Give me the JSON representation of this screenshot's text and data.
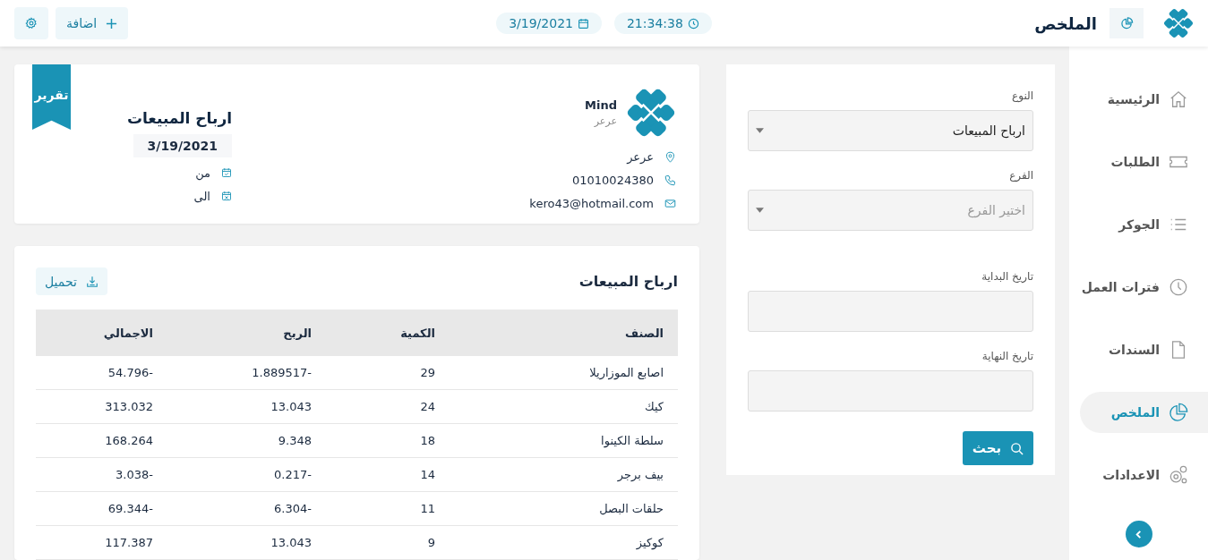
{
  "header": {
    "title": "الملخص",
    "time": "21:34:38",
    "date": "3/19/2021",
    "add_button": "اضافة"
  },
  "sidebar": {
    "items": [
      {
        "label": "الرئيسية",
        "kind": "home",
        "selected": false
      },
      {
        "label": "الطلبات",
        "kind": "ticket",
        "selected": false
      },
      {
        "label": "الجوكر",
        "kind": "list",
        "selected": false
      },
      {
        "label": "فترات العمل",
        "kind": "clock",
        "selected": false
      },
      {
        "label": "السندات",
        "kind": "file",
        "selected": false
      },
      {
        "label": "الملخص",
        "kind": "pie",
        "selected": true
      },
      {
        "label": "الاعدادات",
        "kind": "gears",
        "selected": false
      }
    ]
  },
  "filters": {
    "type": {
      "label": "النوع",
      "value": "ارباح المبيعات"
    },
    "branch": {
      "label": "الفرع",
      "placeholder": "اختير الفرع"
    },
    "start_date": {
      "label": "تاريخ البداية"
    },
    "end_date": {
      "label": "تاريخ النهاية"
    },
    "search_button": "بحث"
  },
  "report": {
    "ribbon": "تقرير",
    "company": "Mind",
    "company_sub": "عرعر",
    "location": "عرعر",
    "phone": "01010024380",
    "email": "kero43@hotmail.com",
    "title": "ارباح المبيعات",
    "date": "3/19/2021",
    "from_label": "من",
    "to_label": "الى"
  },
  "table": {
    "title": "ارباح المبيعات",
    "download_button": "تحميل",
    "columns": [
      "الصنف",
      "الكمية",
      "الربح",
      "الاجمالي"
    ],
    "rows": [
      [
        "اصابع الموزاريلا",
        "29",
        "-1.889517",
        "-54.796"
      ],
      [
        "كيك",
        "24",
        "13.043",
        "313.032"
      ],
      [
        "سلطة الكينوا",
        "18",
        "9.348",
        "168.264"
      ],
      [
        "بيف برجر",
        "14",
        "-0.217",
        "-3.038"
      ],
      [
        "حلقات البصل",
        "11",
        "-6.304",
        "-69.344"
      ],
      [
        "كوكيز",
        "9",
        "13.043",
        "117.387"
      ]
    ]
  }
}
